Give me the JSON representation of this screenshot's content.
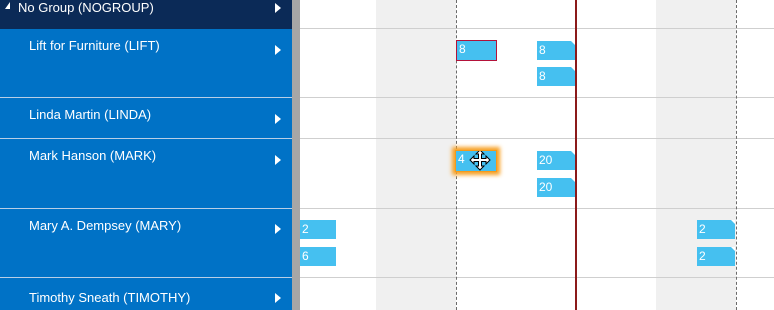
{
  "resources": [
    {
      "label": "No Group (NOGROUP)",
      "type": "group"
    },
    {
      "label": "Lift for Furniture (LIFT)",
      "type": "resource"
    },
    {
      "label": "Linda Martin (LINDA)",
      "type": "resource"
    },
    {
      "label": "Mark Hanson (MARK)",
      "type": "resource"
    },
    {
      "label": "Mary A. Dempsey (MARY)",
      "type": "resource"
    },
    {
      "label": "Timothy Sneath (TIMOTHY)",
      "type": "resource"
    }
  ],
  "appointments": {
    "lift_selected": "8",
    "lift_a": "8",
    "lift_b": "8",
    "mark_dragging": "4",
    "mark_a": "20",
    "mark_b": "20",
    "mary_left_a": "2",
    "mary_left_b": "6",
    "mary_right_a": "2",
    "mary_right_b": "2"
  },
  "colors": {
    "panel": "#0072c6",
    "group_header": "#0b2a57",
    "appointment": "#45c0f0",
    "current_time_line": "#8b1a1a",
    "drag_glow": "#f7a023"
  },
  "icons": {
    "collapse": "collapse-triangle-icon",
    "expand": "expand-arrow-icon",
    "move": "move-cursor-icon"
  }
}
